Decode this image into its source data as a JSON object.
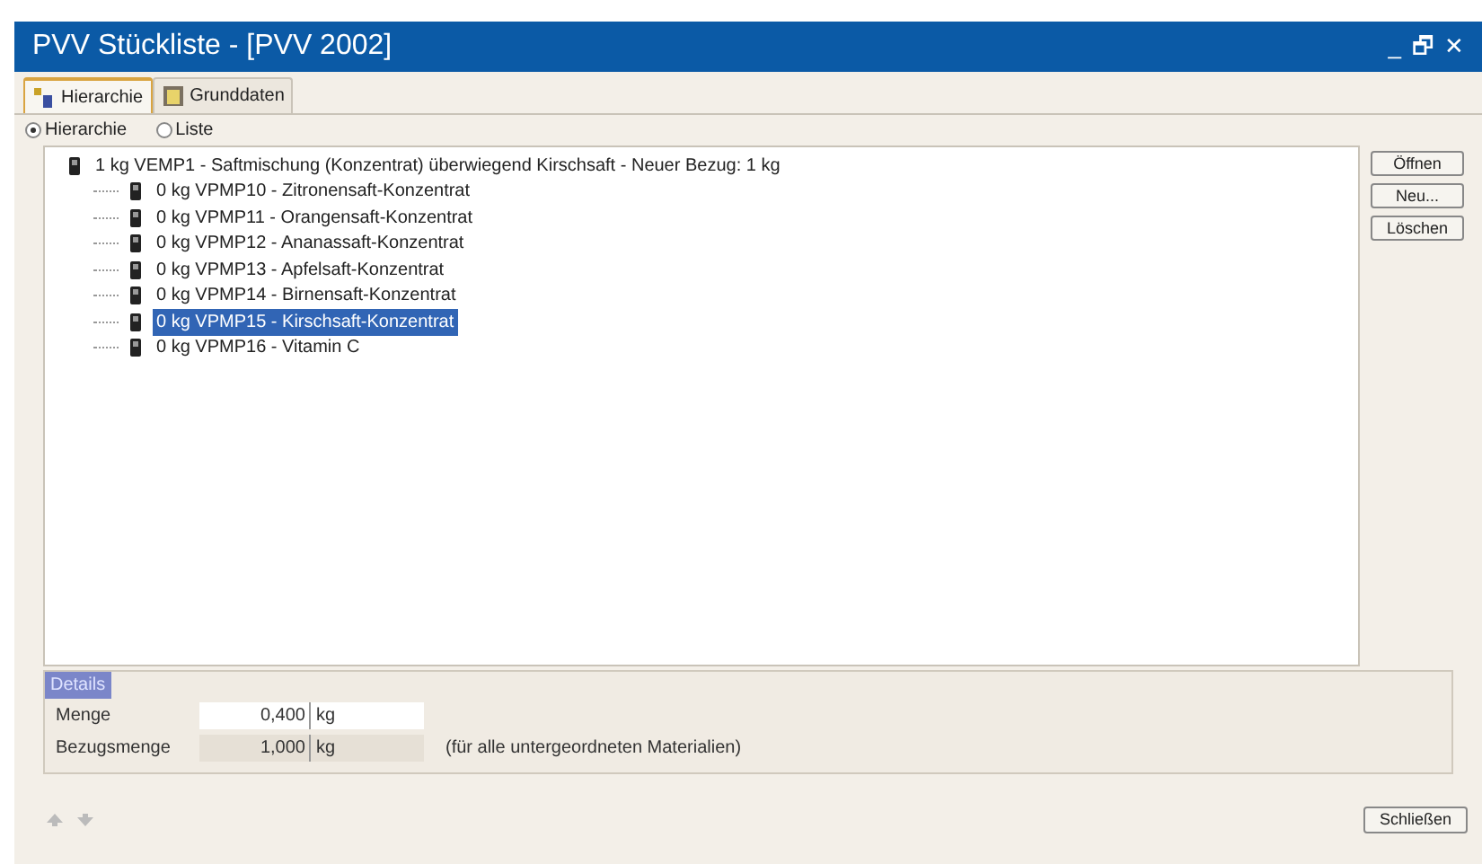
{
  "window": {
    "title": "PVV Stückliste - [PVV 2002]",
    "controls": [
      "_",
      "🗗",
      "✕"
    ]
  },
  "tabs": [
    {
      "label": "Hierarchie",
      "selected": true
    },
    {
      "label": "Grunddaten",
      "selected": false
    }
  ],
  "view_options": [
    {
      "label": "Hierarchie",
      "selected": true
    },
    {
      "label": "Liste",
      "selected": false
    }
  ],
  "tree": [
    {
      "label": "1 kg VEMP1 - Saftmischung (Konzentrat) überwiegend Kirschsaft - Neuer Bezug: 1 kg",
      "selected": false,
      "children": [
        {
          "label": "0 kg VPMP10 - Zitronensaft-Konzentrat",
          "selected": false
        },
        {
          "label": "0 kg VPMP11 - Orangensaft-Konzentrat",
          "selected": false
        },
        {
          "label": "0 kg VPMP12 - Ananassaft-Konzentrat",
          "selected": false
        },
        {
          "label": "0 kg VPMP13 - Apfelsaft-Konzentrat",
          "selected": false
        },
        {
          "label": "0 kg VPMP14 - Birnensaft-Konzentrat",
          "selected": false
        },
        {
          "label": "0 kg VPMP15 - Kirschsaft-Konzentrat",
          "selected": true
        },
        {
          "label": "0 kg VPMP16 - Vitamin C",
          "selected": false
        }
      ]
    }
  ],
  "side_buttons": [
    "Öffnen",
    "Neu...",
    "Löschen"
  ],
  "details": {
    "title": "Details",
    "fields": [
      {
        "label": "Menge",
        "value": "0,400",
        "unit": "kg",
        "disabled": false
      },
      {
        "label": "Bezugsmenge",
        "value": "1,000",
        "unit": "kg",
        "disabled": true,
        "note": "(für alle untergeordneten Materialien)"
      }
    ]
  },
  "close_button": "Schließen"
}
